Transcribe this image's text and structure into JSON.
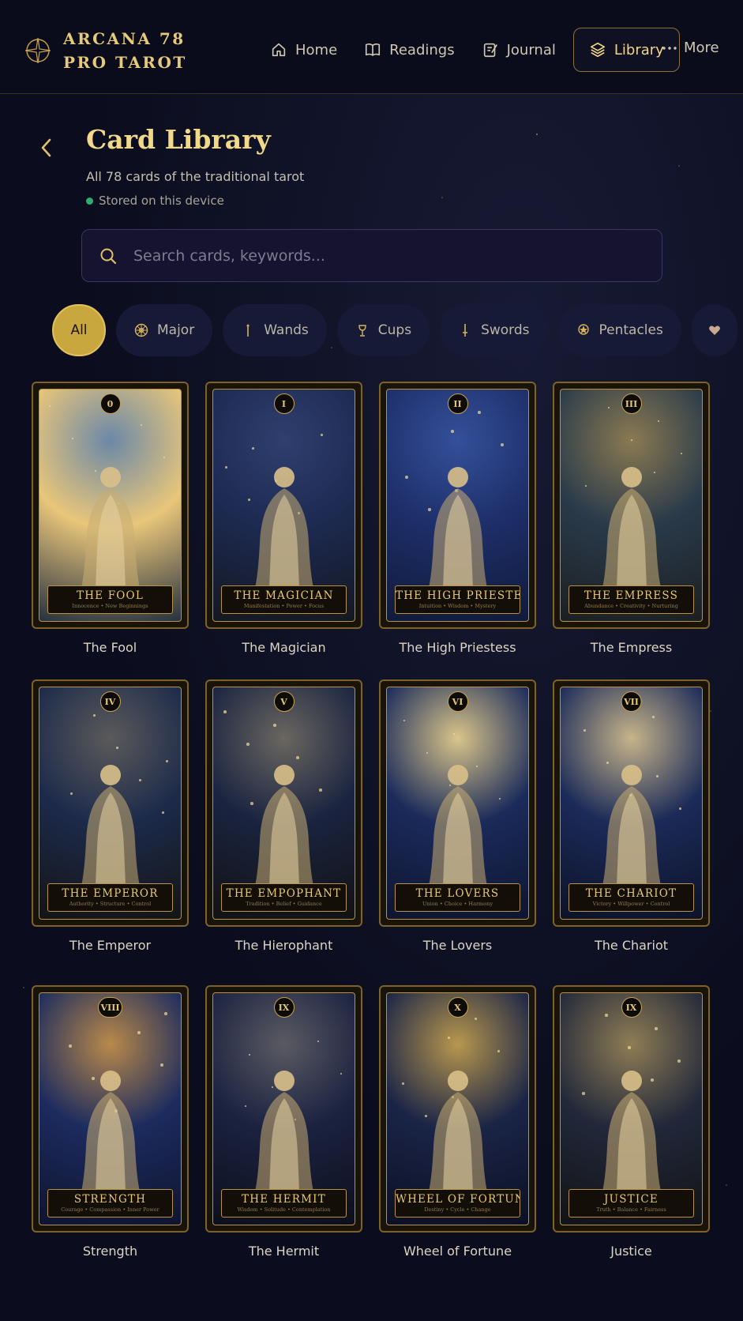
{
  "app": {
    "name": "ARCANA 78 PRO TAROT"
  },
  "nav": {
    "items": [
      {
        "label": "Home",
        "icon": "home-icon"
      },
      {
        "label": "Readings",
        "icon": "book-icon"
      },
      {
        "label": "Journal",
        "icon": "journal-icon"
      },
      {
        "label": "Library",
        "icon": "layers-icon",
        "active": true
      }
    ],
    "more": "More"
  },
  "header": {
    "title": "Card Library",
    "subtitle": "All 78 cards of the traditional tarot",
    "storage": "Stored on this device"
  },
  "search": {
    "placeholder": "Search cards, keywords..."
  },
  "filters": [
    {
      "label": "All",
      "active": true
    },
    {
      "label": "Major",
      "icon": "wheel-icon"
    },
    {
      "label": "Wands",
      "icon": "wand-icon"
    },
    {
      "label": "Cups",
      "icon": "cup-icon"
    },
    {
      "label": "Swords",
      "icon": "sword-icon"
    },
    {
      "label": "Pentacles",
      "icon": "pentacle-icon"
    },
    {
      "label": "",
      "icon": "heart-icon"
    }
  ],
  "cards": [
    {
      "numeral": "0",
      "banner": "THE FOOL",
      "keywords": "Innocence • New Beginnings",
      "caption": "The Fool",
      "palette": [
        "#e9c67a",
        "#6b88a8",
        "#26313f"
      ]
    },
    {
      "numeral": "I",
      "banner": "THE MAGICIAN",
      "keywords": "Manifestation • Power • Focus",
      "caption": "The Magician",
      "palette": [
        "#1d2a52",
        "#2f3f6e",
        "#141821"
      ]
    },
    {
      "numeral": "II",
      "banner": "THE HIGH PRIESTESS",
      "keywords": "Intuition • Wisdom • Mystery",
      "caption": "The High Priestess",
      "palette": [
        "#1e2f6a",
        "#34509a",
        "#101a3a"
      ]
    },
    {
      "numeral": "III",
      "banner": "THE EMPRESS",
      "keywords": "Abundance • Creativity • Nurturing",
      "caption": "The Empress",
      "palette": [
        "#2a3a4a",
        "#8a7a52",
        "#1b1f22"
      ]
    },
    {
      "numeral": "IV",
      "banner": "THE EMPEROR",
      "keywords": "Authority • Structure • Control",
      "caption": "The Emperor",
      "palette": [
        "#1c2a4a",
        "#5b5a5a",
        "#141414"
      ]
    },
    {
      "numeral": "V",
      "banner": "THE EMPOPHANT",
      "keywords": "Tradition • Belief • Guidance",
      "caption": "The Hierophant",
      "palette": [
        "#1a2440",
        "#6a6660",
        "#121212"
      ]
    },
    {
      "numeral": "VI",
      "banner": "THE LOVERS",
      "keywords": "Union • Choice • Harmony",
      "caption": "The Lovers",
      "palette": [
        "#1a2a5a",
        "#d9c58a",
        "#0f1530"
      ]
    },
    {
      "numeral": "VII",
      "banner": "THE CHARIOT",
      "keywords": "Victory • Willpower • Control",
      "caption": "The Chariot",
      "palette": [
        "#1b2a58",
        "#c6b48a",
        "#0d1228"
      ]
    },
    {
      "numeral": "VIII",
      "banner": "STRENGTH",
      "keywords": "Courage • Compassion • Inner Power",
      "caption": "Strength",
      "palette": [
        "#1c2b5e",
        "#b9894a",
        "#0f1430"
      ]
    },
    {
      "numeral": "IX",
      "banner": "THE HERMIT",
      "keywords": "Wisdom • Solitude • Contemplation",
      "caption": "The Hermit",
      "palette": [
        "#1b2240",
        "#5a5a62",
        "#0c0f1c"
      ]
    },
    {
      "numeral": "X",
      "banner": "WHEEL OF FORTUNE",
      "keywords": "Destiny • Cycle • Change",
      "caption": "Wheel of Fortune",
      "palette": [
        "#1a2446",
        "#b8974e",
        "#0c1024"
      ]
    },
    {
      "numeral": "IX",
      "banner": "JUSTICE",
      "keywords": "Truth • Balance • Fairness",
      "caption": "Justice",
      "palette": [
        "#22283a",
        "#8e7d55",
        "#121316"
      ]
    }
  ],
  "colors": {
    "accent": "#e7c97a",
    "background": "#0b0d1e",
    "active_chip": "#c9a73f",
    "storage_dot": "#2fae72"
  }
}
